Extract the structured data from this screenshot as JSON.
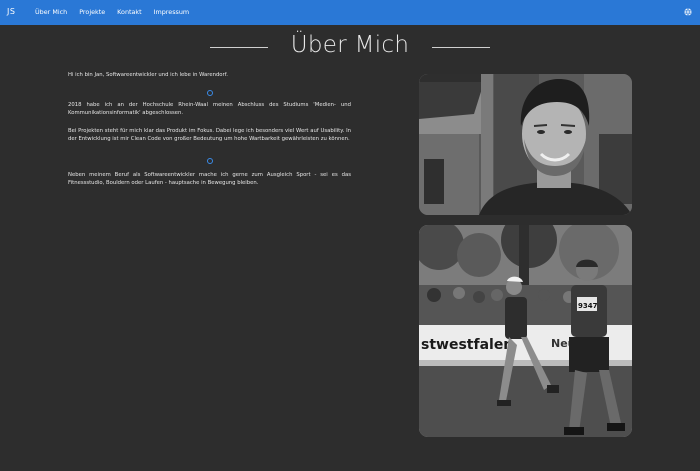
{
  "navbar": {
    "brand": "JS",
    "links": [
      "Über Mich",
      "Projekte",
      "Kontakt",
      "Impressum"
    ],
    "globe_icon": "globe-icon",
    "color": "#2a78d6"
  },
  "page": {
    "title": "Über Mich",
    "paragraphs": [
      "Hi ich bin Jan, Softwareentwickler und ich lebe in Warendorf.",
      "2018 habe ich an der Hochschule Rhein-Waal meinen Abschluss des Studiums 'Medien- und Kommunikationsinformatik' abgeschlossen.",
      "Bei Projekten steht für mich klar das Produkt im Fokus. Dabei lege ich besonders viel Wert auf Usability. In der Entwicklung ist mir Clean Code von großer Bedeutung um hohe Wartbarkeit gewährleisten zu können.",
      "Neben meinem Beruf als Softwareentwickler mache ich gerne zum Ausgleich Sport - sei es das Fitnessstudio, Bouldern oder Laufen - hauptsache in Bewegung bleiben."
    ],
    "photo_banner_text": "stwestfalen",
    "photo_banner_text2": "Neu",
    "bib_number": "9347"
  }
}
